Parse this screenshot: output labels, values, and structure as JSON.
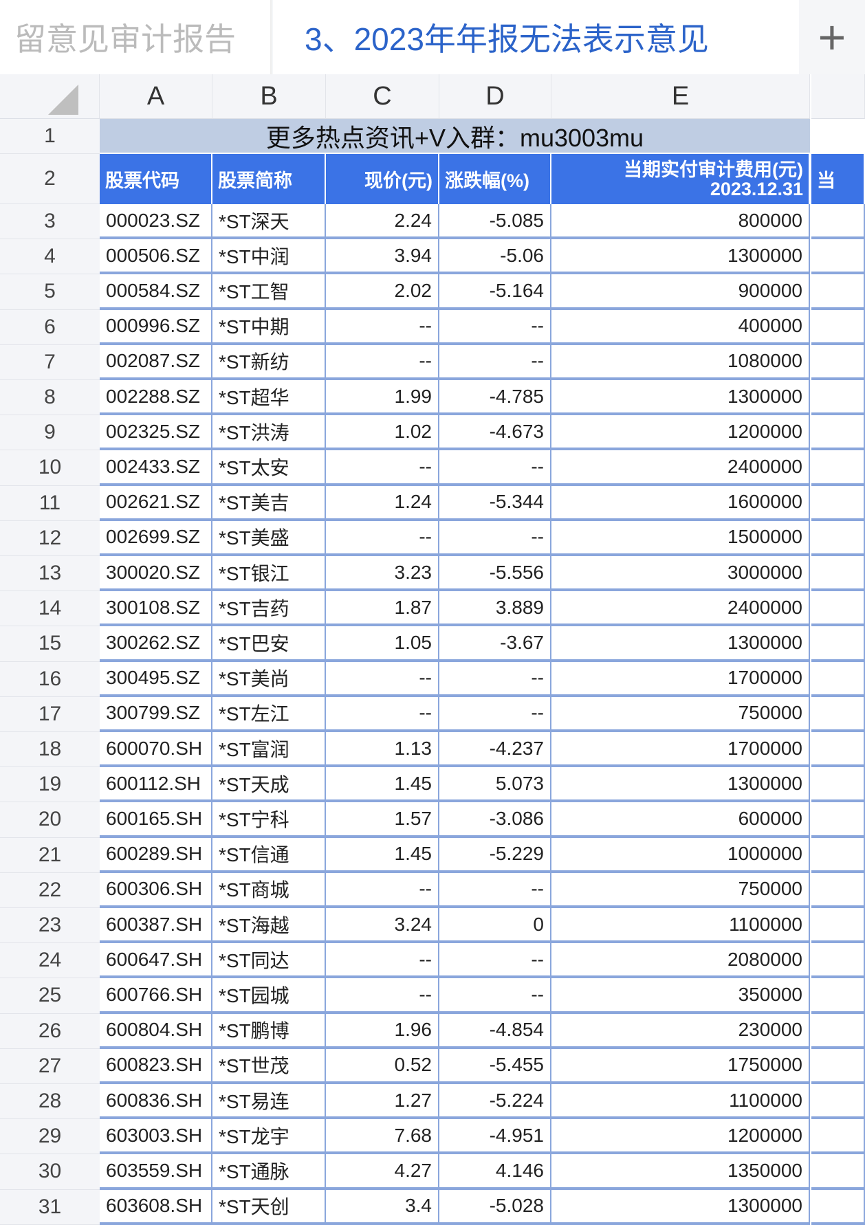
{
  "tabs": [
    {
      "label": "留意见审计报告",
      "active": false
    },
    {
      "label": "3、2023年年报无法表示意见",
      "active": true
    }
  ],
  "add_tab_label": "+",
  "columns": [
    "A",
    "B",
    "C",
    "D",
    "E"
  ],
  "banner": "更多热点资讯+V入群：mu3003mu",
  "headers": {
    "code": "股票代码",
    "name": "股票简称",
    "price": "现价(元)",
    "change": "涨跌幅(%)",
    "fee": "当期实付审计费用(元)",
    "fee_date": "2023.12.31",
    "next": "当"
  },
  "rows": [
    [
      "3",
      "000023.SZ",
      "*ST深天",
      "2.24",
      "-5.085",
      "800000"
    ],
    [
      "4",
      "000506.SZ",
      "*ST中润",
      "3.94",
      "-5.06",
      "1300000"
    ],
    [
      "5",
      "000584.SZ",
      "*ST工智",
      "2.02",
      "-5.164",
      "900000"
    ],
    [
      "6",
      "000996.SZ",
      "*ST中期",
      "--",
      "--",
      "400000"
    ],
    [
      "7",
      "002087.SZ",
      "*ST新纺",
      "--",
      "--",
      "1080000"
    ],
    [
      "8",
      "002288.SZ",
      "*ST超华",
      "1.99",
      "-4.785",
      "1300000"
    ],
    [
      "9",
      "002325.SZ",
      "*ST洪涛",
      "1.02",
      "-4.673",
      "1200000"
    ],
    [
      "10",
      "002433.SZ",
      "*ST太安",
      "--",
      "--",
      "2400000"
    ],
    [
      "11",
      "002621.SZ",
      "*ST美吉",
      "1.24",
      "-5.344",
      "1600000"
    ],
    [
      "12",
      "002699.SZ",
      "*ST美盛",
      "--",
      "--",
      "1500000"
    ],
    [
      "13",
      "300020.SZ",
      "*ST银江",
      "3.23",
      "-5.556",
      "3000000"
    ],
    [
      "14",
      "300108.SZ",
      "*ST吉药",
      "1.87",
      "3.889",
      "2400000"
    ],
    [
      "15",
      "300262.SZ",
      "*ST巴安",
      "1.05",
      "-3.67",
      "1300000"
    ],
    [
      "16",
      "300495.SZ",
      "*ST美尚",
      "--",
      "--",
      "1700000"
    ],
    [
      "17",
      "300799.SZ",
      "*ST左江",
      "--",
      "--",
      "750000"
    ],
    [
      "18",
      "600070.SH",
      "*ST富润",
      "1.13",
      "-4.237",
      "1700000"
    ],
    [
      "19",
      "600112.SH",
      "*ST天成",
      "1.45",
      "5.073",
      "1300000"
    ],
    [
      "20",
      "600165.SH",
      "*ST宁科",
      "1.57",
      "-3.086",
      "600000"
    ],
    [
      "21",
      "600289.SH",
      "*ST信通",
      "1.45",
      "-5.229",
      "1000000"
    ],
    [
      "22",
      "600306.SH",
      "*ST商城",
      "--",
      "--",
      "750000"
    ],
    [
      "23",
      "600387.SH",
      "*ST海越",
      "3.24",
      "0",
      "1100000"
    ],
    [
      "24",
      "600647.SH",
      "*ST同达",
      "--",
      "--",
      "2080000"
    ],
    [
      "25",
      "600766.SH",
      "*ST园城",
      "--",
      "--",
      "350000"
    ],
    [
      "26",
      "600804.SH",
      "*ST鹏博",
      "1.96",
      "-4.854",
      "230000"
    ],
    [
      "27",
      "600823.SH",
      "*ST世茂",
      "0.52",
      "-5.455",
      "1750000"
    ],
    [
      "28",
      "600836.SH",
      "*ST易连",
      "1.27",
      "-5.224",
      "1100000"
    ],
    [
      "29",
      "603003.SH",
      "*ST龙宇",
      "7.68",
      "-4.951",
      "1200000"
    ],
    [
      "30",
      "603559.SH",
      "*ST通脉",
      "4.27",
      "4.146",
      "1350000"
    ],
    [
      "31",
      "603608.SH",
      "*ST天创",
      "3.4",
      "-5.028",
      "1300000"
    ]
  ]
}
